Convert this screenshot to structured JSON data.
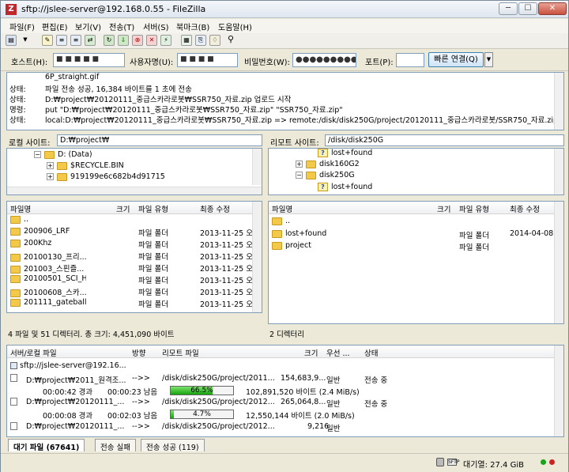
{
  "window": {
    "title": "sftp://jslee-server@192.168.0.55 - FileZilla",
    "app_icon": "Z",
    "min": "─",
    "max": "☐",
    "close": "✕"
  },
  "menu": [
    "파일(F)",
    "편집(E)",
    "보기(V)",
    "전송(T)",
    "서버(S)",
    "북마크(B)",
    "도움말(H)"
  ],
  "quickconnect": {
    "host_label": "호스트(H):",
    "host_value": "■ ■ ■ ■ ■",
    "user_label": "사용자명(U):",
    "user_value": "■ ■ ■ ■",
    "pass_label": "비밀번호(W):",
    "pass_value": "●●●●●●●●●",
    "port_label": "포트(P):",
    "port_value": "",
    "connect_button": "빠른 연결(Q)"
  },
  "log": [
    {
      "type": "",
      "msg": "6P_straight.gif"
    },
    {
      "type": "상태:",
      "msg": "파일 전송 성공, 16,384 바이트를 1 초에 전송"
    },
    {
      "type": "상태:",
      "msg": "D:₩project₩20120111_중급스카라로봇₩SSR750_자료.zip 업로드 시작"
    },
    {
      "type": "명령:",
      "msg": "put \"D:₩project₩20120111_중급스카라로봇₩SSR750_자료.zip\" \"SSR750_자료.zip\""
    },
    {
      "type": "상태:",
      "msg": "local:D:₩project₩20120111_중급스카라로봇₩SSR750_자료.zip => remote:/disk/disk250G/project/20120111_중급스카라로봇/SSR750_자료.zip"
    }
  ],
  "local": {
    "site_label": "로컬 사이트:",
    "site_path": "D:₩project₩",
    "tree": [
      {
        "label": "D: (Data)",
        "exp": "−"
      },
      {
        "label": "$RECYCLE.BIN",
        "exp": "+"
      },
      {
        "label": "919199e6c682b4d91715",
        "exp": "+"
      }
    ],
    "headers": {
      "name": "파일명",
      "size": "크기",
      "type": "파일 유형",
      "modified": "최종 수정"
    },
    "files": [
      {
        "name": "..",
        "type": "",
        "modified": ""
      },
      {
        "name": "200906_LRF",
        "type": "파일 폴더",
        "modified": "2013-11-25 오"
      },
      {
        "name": "200Khz",
        "type": "파일 폴더",
        "modified": "2013-11-25 오"
      },
      {
        "name": "20100130_프리...",
        "type": "파일 폴더",
        "modified": "2013-11-25 오"
      },
      {
        "name": "201003_스핀즐...",
        "type": "파일 폴더",
        "modified": "2013-11-25 오"
      },
      {
        "name": "20100501_SCI_H",
        "type": "파일 폴더",
        "modified": "2013-11-25 오"
      },
      {
        "name": "20100608_스카...",
        "type": "파일 폴더",
        "modified": "2013-11-25 오"
      },
      {
        "name": "201111_gateball",
        "type": "파일 폴더",
        "modified": "2013-11-25 오"
      }
    ],
    "status": "4 파일 및 51 디렉터리. 총 크기: 4,451,090 바이트"
  },
  "remote": {
    "site_label": "리모트 사이트:",
    "site_path": "/disk/disk250G",
    "tree": [
      {
        "label": "lost+found",
        "exp": "",
        "q": true
      },
      {
        "label": "disk160G2",
        "exp": "+",
        "q": false
      },
      {
        "label": "disk250G",
        "exp": "−",
        "q": false
      },
      {
        "label": "lost+found",
        "exp": "",
        "q": true
      }
    ],
    "headers": {
      "name": "파일명",
      "size": "크기",
      "type": "파일 유형",
      "modified": "최종 수정"
    },
    "files": [
      {
        "name": "..",
        "type": "",
        "modified": ""
      },
      {
        "name": "lost+found",
        "type": "파일 폴더",
        "modified": "2014-04-08"
      },
      {
        "name": "project",
        "type": "파일 폴더",
        "modified": ""
      }
    ],
    "status": "2 디렉터리"
  },
  "queue": {
    "headers": {
      "file": "서버/로컬 파일",
      "dir": "방향",
      "remote": "리모트 파일",
      "size": "크기",
      "priority": "우선 ...",
      "status": "상태"
    },
    "server": "sftp://jslee-server@192.16...",
    "items": [
      {
        "local": "D:₩project₩2011_원격조...",
        "dir": "-->>",
        "remote": "/disk/disk250G/project/2011...",
        "size": "154,683,9...",
        "priority": "일반",
        "status": "전송 중",
        "elapsed": "00:00:42 경과",
        "left": "00:00:23 남음",
        "percent_label": "66.5%",
        "progress": 0.665,
        "bytes": "102,891,520 바이트 (2.4 MiB/s)"
      },
      {
        "local": "D:₩project₩20120111_...",
        "dir": "-->>",
        "remote": "/disk/disk250G/project/2012...",
        "size": "265,064,8...",
        "priority": "일반",
        "status": "전송 중",
        "elapsed": "00:00:08 경과",
        "left": "00:02:03 남음",
        "percent_label": "4.7%",
        "progress": 0.047,
        "bytes": "12,550,144 바이트 (2.0 MiB/s)"
      },
      {
        "local": "D:₩project₩20120111_...",
        "dir": "-->>",
        "remote": "/disk/disk250G/project/2012...",
        "size": "9,216",
        "priority": "일반",
        "status": ""
      }
    ]
  },
  "tabs": [
    "대기 파일 (67641)",
    "전송 실패",
    "전송 성공 (119)"
  ],
  "bottom": {
    "queue_label": "대기열: 27.4 GiB",
    "colors": {
      "green": "#19a319",
      "red": "#cc2222"
    }
  }
}
